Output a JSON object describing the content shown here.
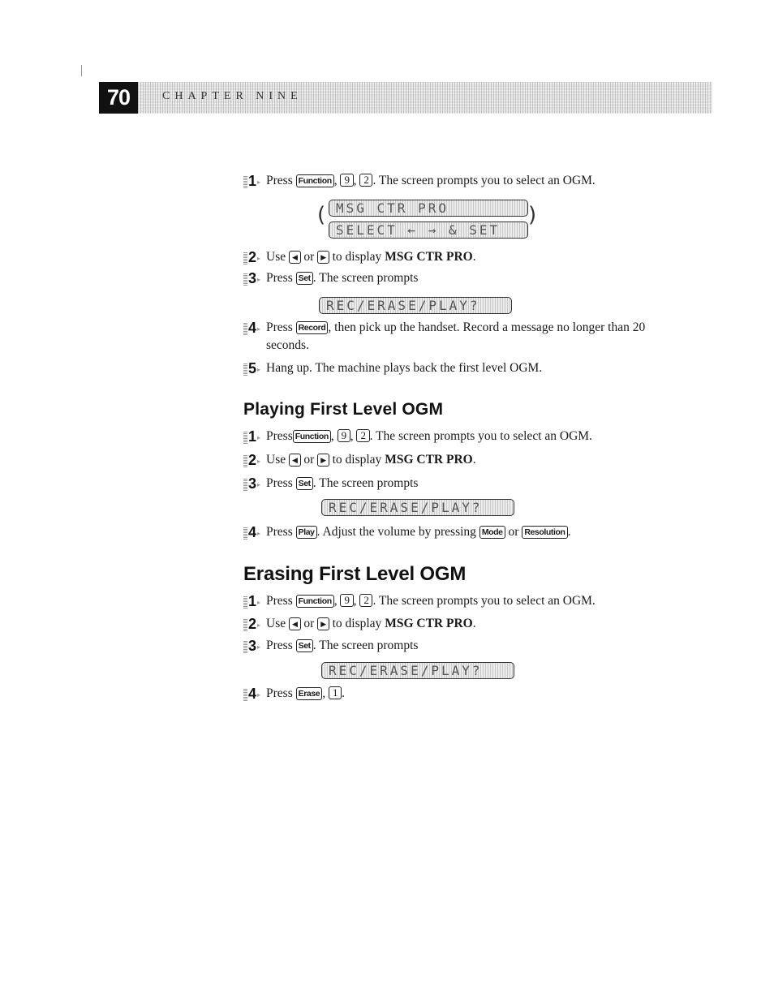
{
  "header": {
    "page_number": "70",
    "chapter": "CHAPTER NINE"
  },
  "section1": {
    "steps": [
      {
        "num": "1",
        "pre": "Press ",
        "keys": [
          "Function",
          "9",
          "2"
        ],
        "post": ". The screen prompts you to select an OGM."
      },
      {
        "num": "2",
        "pre": "Use ",
        "or": " or ",
        "post": " to display ",
        "bold": "MSG CTR PRO",
        "end": "."
      },
      {
        "num": "3",
        "pre": "Press ",
        "key": "Set",
        "post": ". The screen prompts"
      },
      {
        "num": "4",
        "pre": "Press ",
        "key": "Record",
        "post": ", then pick up the handset. Record a message no longer than 20 seconds."
      },
      {
        "num": "5",
        "text": "Hang up. The machine plays back the first level OGM."
      }
    ],
    "lcd_line1": "MSG CTR PRO",
    "lcd_line2": "SELECT ← → & SET",
    "lcd_prompt": "REC/ERASE/PLAY?"
  },
  "section2": {
    "heading": "Playing First Level OGM",
    "steps": [
      {
        "num": "1",
        "pre": "Press",
        "keys": [
          "Function",
          "9",
          "2"
        ],
        "post": ". The screen prompts you to select an OGM."
      },
      {
        "num": "2",
        "pre": "Use ",
        "or": " or ",
        "post": " to display ",
        "bold": "MSG CTR PRO",
        "end": "."
      },
      {
        "num": "3",
        "pre": "Press ",
        "key": "Set",
        "post": ". The screen prompts"
      },
      {
        "num": "4",
        "pre": "Press ",
        "key": "Play",
        "mid": ". Adjust the volume by pressing ",
        "key2": "Mode",
        "or": " or ",
        "key3": "Resolution",
        "end": "."
      }
    ],
    "lcd_prompt": "REC/ERASE/PLAY?"
  },
  "section3": {
    "heading": "Erasing First Level OGM",
    "steps": [
      {
        "num": "1",
        "pre": "Press ",
        "keys": [
          "Function",
          "9",
          "2"
        ],
        "post": ". The screen prompts you to select an OGM."
      },
      {
        "num": "2",
        "pre": "Use ",
        "or": " or ",
        "post": " to display ",
        "bold": "MSG CTR PRO",
        "end": "."
      },
      {
        "num": "3",
        "pre": "Press ",
        "key": "Set",
        "post": ". The screen prompts"
      },
      {
        "num": "4",
        "pre": "Press ",
        "key": "Erase",
        "key2": "1",
        "end": "."
      }
    ],
    "lcd_prompt": "REC/ERASE/PLAY?"
  },
  "icons": {
    "left_arrow_key": "◀",
    "right_arrow_key": "▶"
  },
  "punct": {
    "comma": ", "
  }
}
